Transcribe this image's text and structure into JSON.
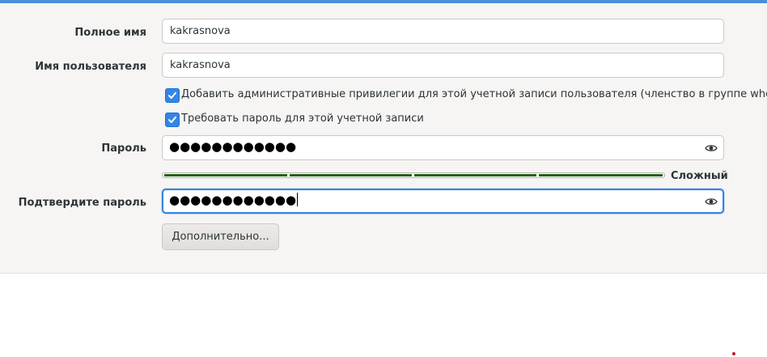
{
  "form": {
    "full_name_label": "Полное имя",
    "full_name_value": "kakrasnova",
    "username_label": "Имя пользователя",
    "username_value": "kakrasnova",
    "admin_checkbox_label": "Добавить административные привилегии для этой учетной записи пользователя (членство в группе wheel)",
    "admin_checked": true,
    "require_password_label": "Требовать пароль для этой учетной записи",
    "require_password_checked": true,
    "password_label": "Пароль",
    "password_mask": "●●●●●●●●●●●●",
    "strength_text": "Сложный",
    "strength_level": 1.0,
    "confirm_label": "Подтвердите пароль",
    "confirm_mask": "●●●●●●●●●●●●",
    "advanced_button_label": "Дополнительно..."
  },
  "icons": {
    "reveal": "eye-icon",
    "check": "checkmark-icon"
  },
  "colors": {
    "accent": "#3584e4",
    "strength_bar": "#26601a",
    "panel_bg": "#f6f5f4"
  }
}
